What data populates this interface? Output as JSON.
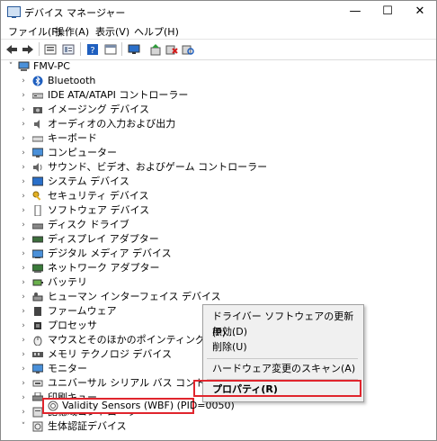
{
  "window": {
    "title": "デバイス マネージャー",
    "minimize": "—",
    "maximize": "☐",
    "close": "✕"
  },
  "menu": [
    "ファイル(F)",
    "操作(A)",
    "表示(V)",
    "ヘルプ(H)"
  ],
  "toolbar": [
    "back-icon",
    "forward-icon",
    "device-list-icon",
    "properties-icon",
    "help-icon",
    "console-icon",
    "monitor-icon",
    "update-driver-icon",
    "uninstall-icon",
    "scan-icon"
  ],
  "tree": {
    "root": "FMV-PC",
    "items": [
      "Bluetooth",
      "IDE ATA/ATAPI コントローラー",
      "イメージング デバイス",
      "オーディオの入力および出力",
      "キーボード",
      "コンピューター",
      "サウンド、ビデオ、およびゲーム コントローラー",
      "システム デバイス",
      "セキュリティ デバイス",
      "ソフトウェア デバイス",
      "ディスク ドライブ",
      "ディスプレイ アダプター",
      "デジタル メディア デバイス",
      "ネットワーク アダプター",
      "バッテリ",
      "ヒューマン インターフェイス デバイス",
      "ファームウェア",
      "プロセッサ",
      "マウスとそのほかのポインティング デバイス",
      "メモリ テクノロジ デバイス",
      "モニター",
      "ユニバーサル シリアル バス コントローラー",
      "印刷キュー",
      "記憶域コントローラー",
      "生体認証デバイス"
    ],
    "child": "Validity Sensors (WBF) (PID=0050)"
  },
  "context_menu": {
    "update": "ドライバー ソフトウェアの更新(P)...",
    "disable": "無効(D)",
    "delete": "削除(U)",
    "scan": "ハードウェア変更のスキャン(A)",
    "properties": "プロパティ(R)"
  }
}
